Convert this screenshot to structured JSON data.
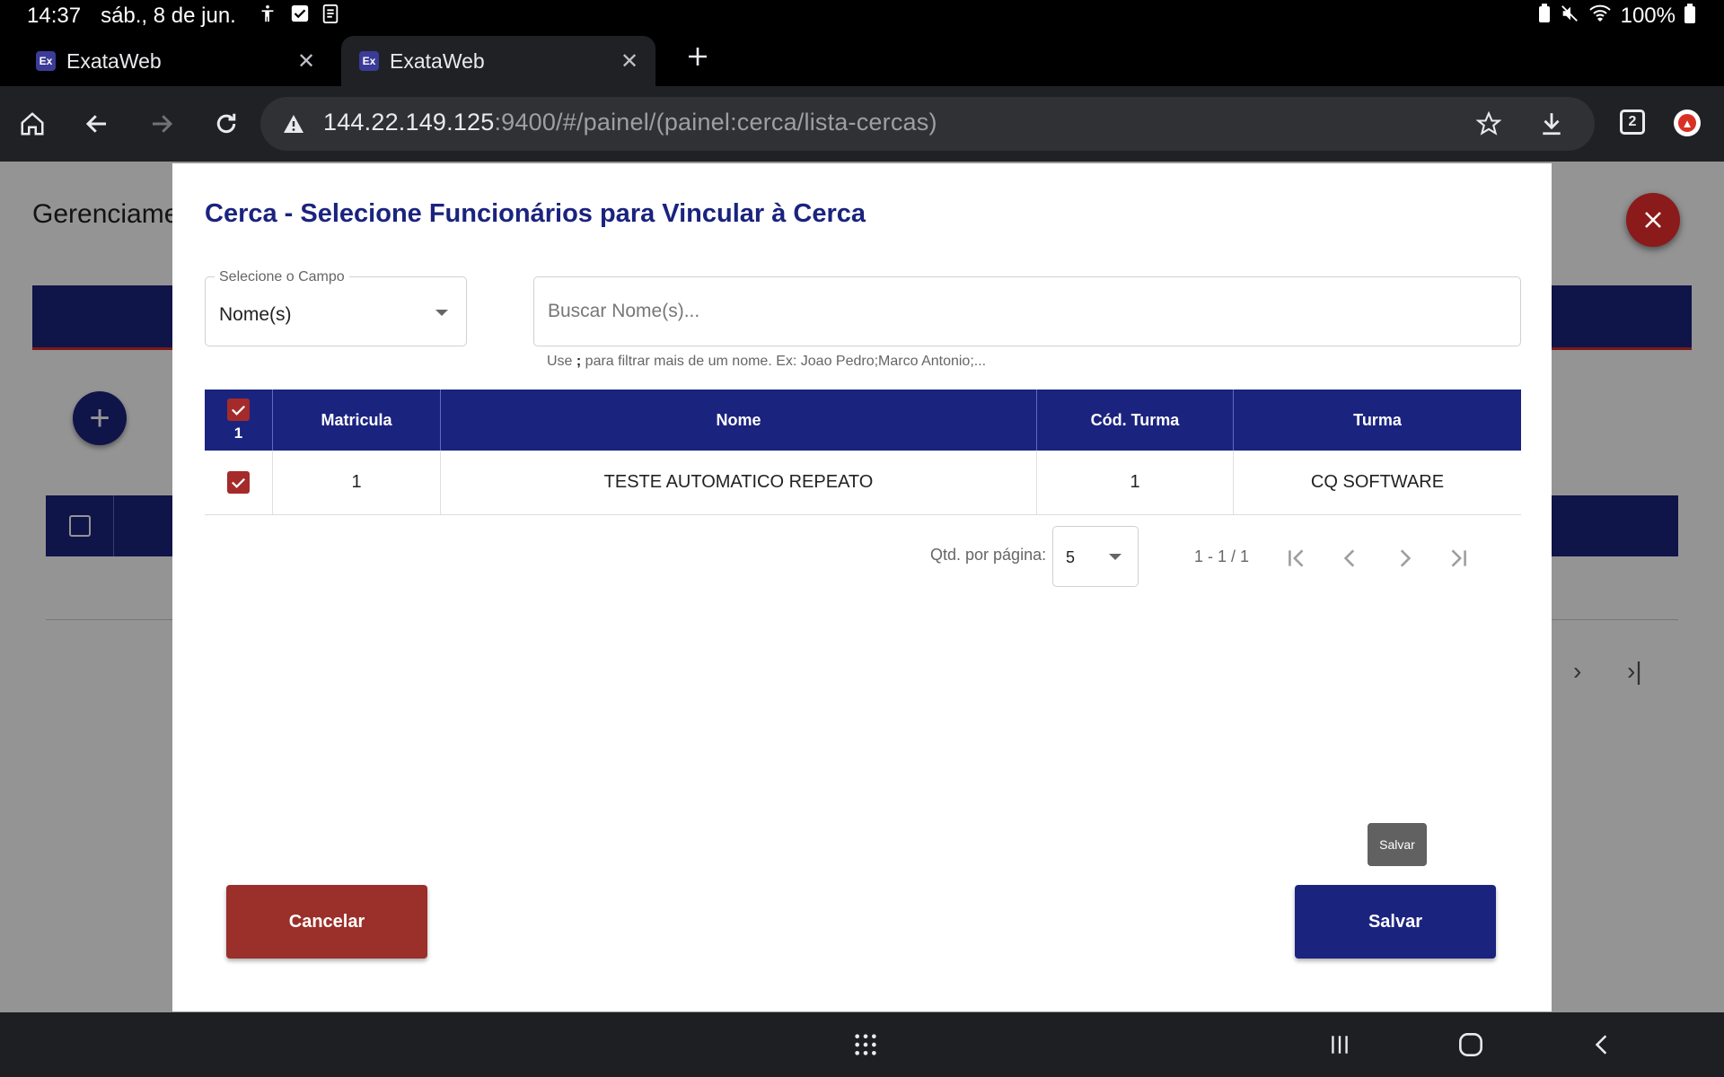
{
  "status_bar": {
    "time": "14:37",
    "date": "sáb., 8 de jun.",
    "battery": "100%"
  },
  "tabs": [
    {
      "title": "ExataWeb",
      "favicon": "Ex"
    },
    {
      "title": "ExataWeb",
      "favicon": "Ex"
    }
  ],
  "address_bar": {
    "host": "144.22.149.125",
    "rest": ":9400/#/painel/(painel:cerca/lista-cercas)",
    "tab_count": "2"
  },
  "background_page": {
    "title": "Gerenciame"
  },
  "dialog": {
    "title": "Cerca - Selecione Funcionários para Vincular à Cerca",
    "field_select": {
      "legend": "Selecione o Campo",
      "value": "Nome(s)"
    },
    "search": {
      "placeholder": "Buscar Nome(s)...",
      "value": ""
    },
    "hint_prefix": "Use ",
    "hint_separator": ";",
    "hint_suffix": " para filtrar mais de um nome. Ex: Joao Pedro;Marco Antonio;...",
    "table": {
      "selected_count": "1",
      "columns": [
        "Matricula",
        "Nome",
        "Cód. Turma",
        "Turma"
      ],
      "rows": [
        {
          "checked": true,
          "matricula": "1",
          "nome": "TESTE AUTOMATICO REPEATO",
          "cod_turma": "1",
          "turma": "CQ SOFTWARE"
        }
      ]
    },
    "paginator": {
      "label": "Qtd. por página:",
      "page_size": "5",
      "range": "1 - 1 / 1"
    },
    "tooltip": "Salvar",
    "cancel_label": "Cancelar",
    "save_label": "Salvar"
  },
  "colors": {
    "primary": "#1a237e",
    "danger": "#9b2f2a",
    "checkbox": "#a52a2a"
  }
}
